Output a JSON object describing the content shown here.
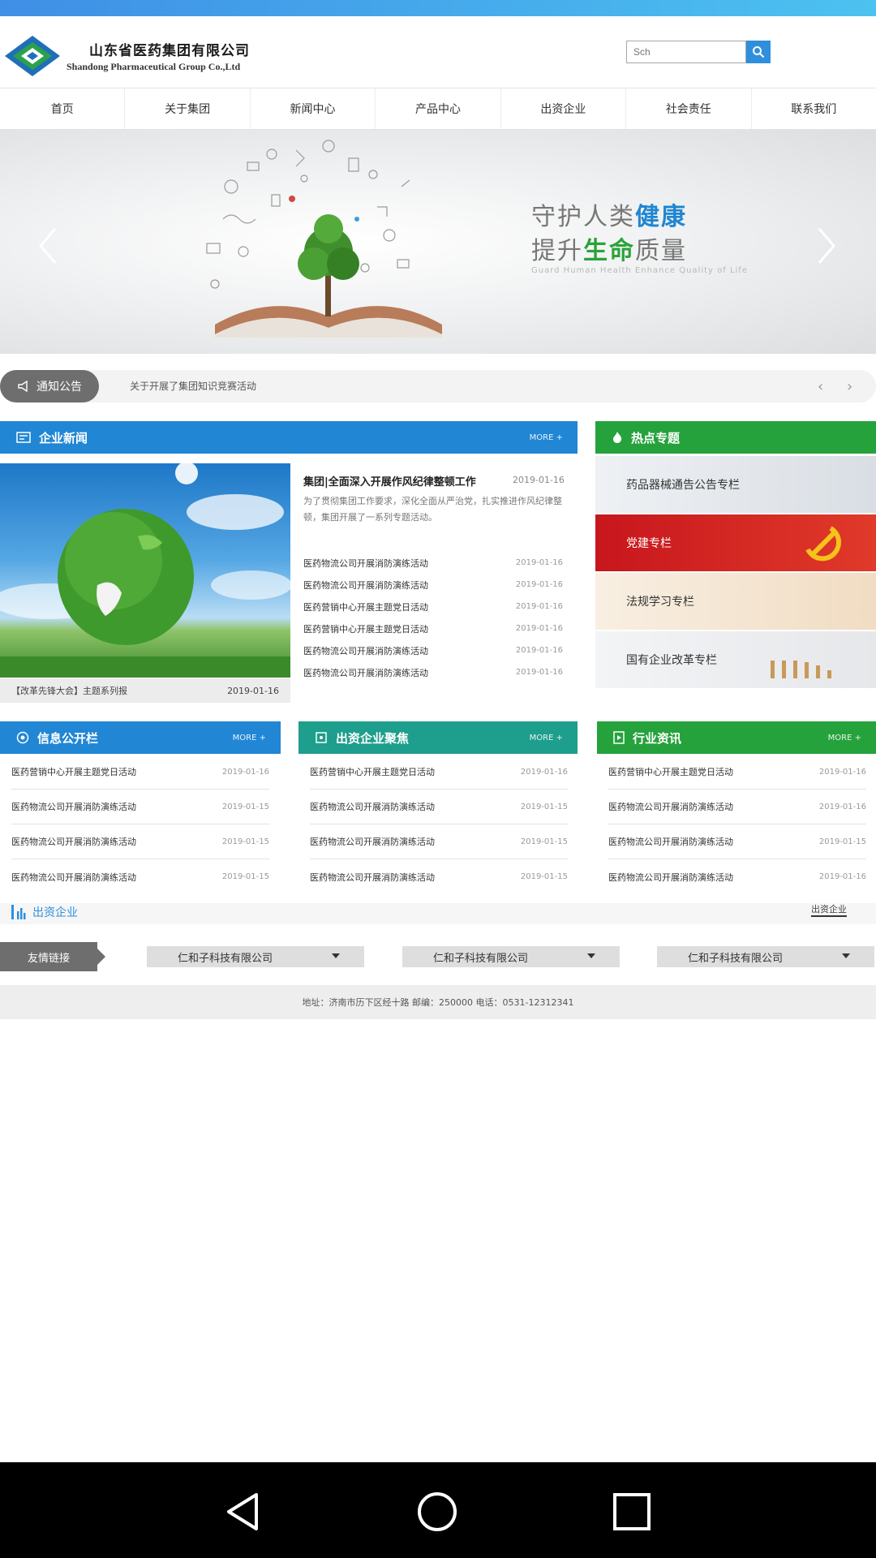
{
  "header": {
    "company_cn": "山东省医药集团有限公司",
    "company_en": "Shandong Pharmaceutical Group Co.,Ltd",
    "search_placeholder": "Sch"
  },
  "nav": {
    "items": [
      "首页",
      "关于集团",
      "新闻中心",
      "产品中心",
      "出资企业",
      "社会责任",
      "联系我们"
    ]
  },
  "banner": {
    "line1_plain": "守护人类",
    "line1_highlight": "健康",
    "line2_plain": "提升",
    "line2_highlight": "生命",
    "line2_tail": "质量",
    "subtitle": "Guard Human Health  Enhance Quality of Life"
  },
  "notice": {
    "tag": "通知公告",
    "text": "关于开展了集团知识竞赛活动"
  },
  "company_news": {
    "title": "企业新闻",
    "more": "MORE +",
    "caption": "【改革先锋大会】主题系列报",
    "caption_date": "2019-01-16",
    "headline": "集团|全面深入开展作风纪律整顿工作",
    "headline_date": "2019-01-16",
    "headline_desc": "为了贯彻集团工作要求，深化全面从严治党，扎实推进作风纪律整顿，集团开展了一系列专题活动。",
    "items": [
      {
        "title": "医药物流公司开展消防演练活动",
        "date": "2019-01-16"
      },
      {
        "title": "医药物流公司开展消防演练活动",
        "date": "2019-01-16"
      },
      {
        "title": "医药营销中心开展主题党日活动",
        "date": "2019-01-16"
      },
      {
        "title": "医药营销中心开展主题党日活动",
        "date": "2019-01-16"
      },
      {
        "title": "医药物流公司开展消防演练活动",
        "date": "2019-01-16"
      },
      {
        "title": "医药物流公司开展消防演练活动",
        "date": "2019-01-16"
      }
    ]
  },
  "hot_topics": {
    "title": "热点专题",
    "items": [
      "药品器械通告公告专栏",
      "党建专栏",
      "法规学习专栏",
      "国有企业改革专栏"
    ]
  },
  "info_disclosure": {
    "title": "信息公开栏",
    "more": "MORE +",
    "items": [
      {
        "title": "医药营销中心开展主题党日活动",
        "date": "2019-01-16"
      },
      {
        "title": "医药物流公司开展消防演练活动",
        "date": "2019-01-15"
      },
      {
        "title": "医药物流公司开展消防演练活动",
        "date": "2019-01-15"
      },
      {
        "title": "医药物流公司开展消防演练活动",
        "date": "2019-01-15"
      }
    ]
  },
  "enterprise_focus": {
    "title": "出资企业聚焦",
    "more": "MORE +",
    "items": [
      {
        "title": "医药营销中心开展主题党日活动",
        "date": "2019-01-16"
      },
      {
        "title": "医药物流公司开展消防演练活动",
        "date": "2019-01-15"
      },
      {
        "title": "医药物流公司开展消防演练活动",
        "date": "2019-01-15"
      },
      {
        "title": "医药物流公司开展消防演练活动",
        "date": "2019-01-15"
      }
    ]
  },
  "industry_news": {
    "title": "行业资讯",
    "more": "MORE +",
    "items": [
      {
        "title": "医药营销中心开展主题党日活动",
        "date": "2019-01-16"
      },
      {
        "title": "医药物流公司开展消防演练活动",
        "date": "2019-01-16"
      },
      {
        "title": "医药物流公司开展消防演练活动",
        "date": "2019-01-15"
      },
      {
        "title": "医药物流公司开展消防演练活动",
        "date": "2019-01-16"
      }
    ]
  },
  "invested": {
    "title": "出资企业",
    "more": "出资企业"
  },
  "links": {
    "tag": "友情链接",
    "selects": [
      "仁和子科技有限公司",
      "仁和子科技有限公司",
      "仁和子科技有限公司"
    ]
  },
  "footer": {
    "text": "地址：济南市历下区经十路 邮编：250000 电话：0531-12312341"
  },
  "colors": {
    "blue": "#2186d4",
    "teal": "#1e9e8c",
    "green": "#25a23c",
    "gray_tag": "#6e6e6e"
  }
}
